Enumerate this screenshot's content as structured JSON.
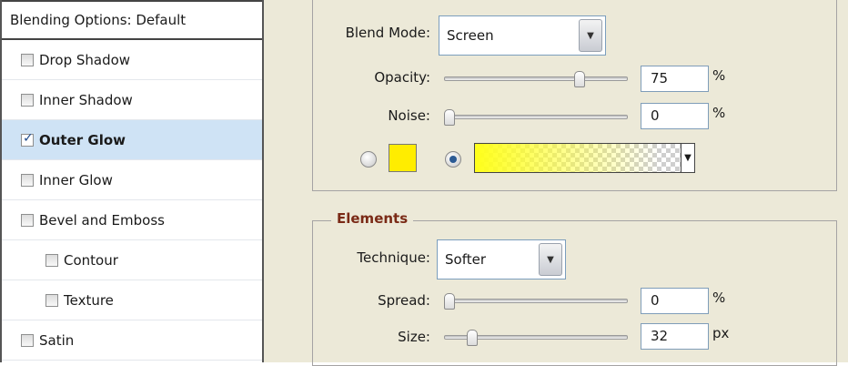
{
  "styles_list": {
    "header": "Blending Options: Default",
    "items": [
      {
        "label": "Drop Shadow",
        "checked": false,
        "active": false,
        "indent": false
      },
      {
        "label": "Inner Shadow",
        "checked": false,
        "active": false,
        "indent": false
      },
      {
        "label": "Outer Glow",
        "checked": true,
        "active": true,
        "indent": false
      },
      {
        "label": "Inner Glow",
        "checked": false,
        "active": false,
        "indent": false
      },
      {
        "label": "Bevel and Emboss",
        "checked": false,
        "active": false,
        "indent": false
      },
      {
        "label": "Contour",
        "checked": false,
        "active": false,
        "indent": true
      },
      {
        "label": "Texture",
        "checked": false,
        "active": false,
        "indent": true
      },
      {
        "label": "Satin",
        "checked": false,
        "active": false,
        "indent": false
      }
    ]
  },
  "structure": {
    "blend_mode_label": "Blend Mode:",
    "blend_mode_value": "Screen",
    "opacity_label": "Opacity:",
    "opacity_value": "75",
    "opacity_unit": "%",
    "opacity_level": 0.75,
    "noise_label": "Noise:",
    "noise_value": "0",
    "noise_unit": "%",
    "noise_level": 0,
    "color_swatch": "#ffed00"
  },
  "elements": {
    "legend": "Elements",
    "technique_label": "Technique:",
    "technique_value": "Softer",
    "spread_label": "Spread:",
    "spread_value": "0",
    "spread_unit": "%",
    "spread_level": 0,
    "size_label": "Size:",
    "size_value": "32",
    "size_unit": "px",
    "size_level": 0.13
  },
  "colors": {
    "legend_text": "#7a2a16",
    "active_row": "#cfe3f5",
    "panel_bg": "#ece9d8"
  }
}
